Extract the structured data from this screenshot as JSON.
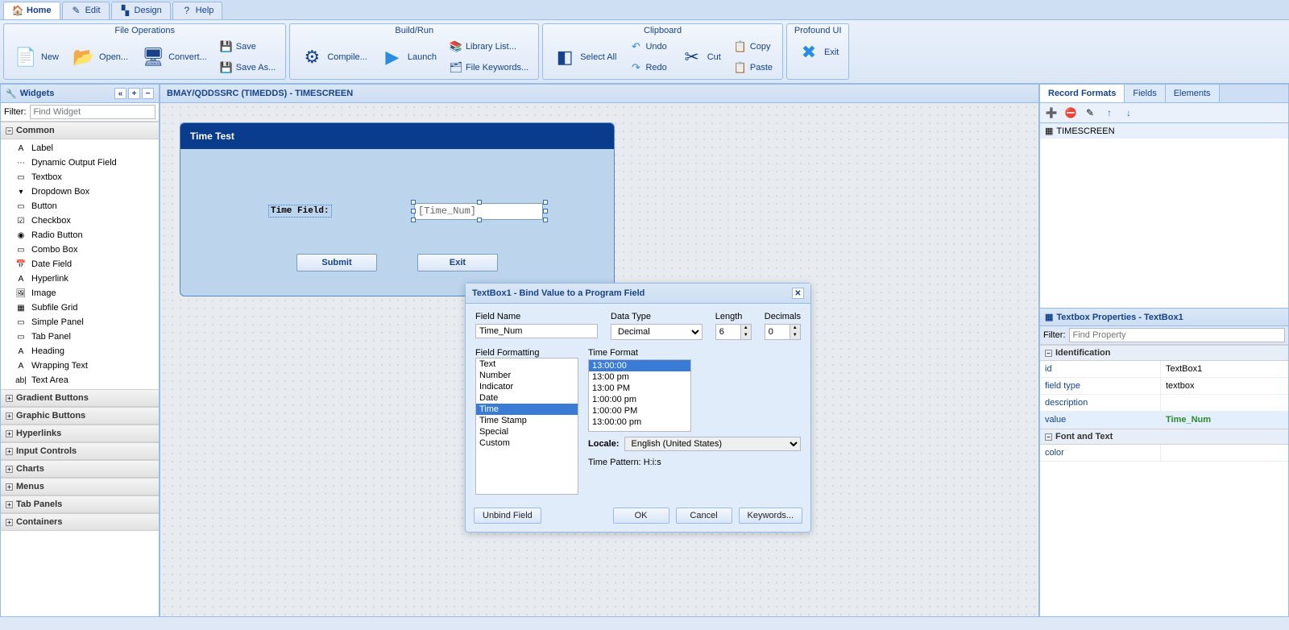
{
  "tabs": {
    "home": "Home",
    "edit": "Edit",
    "design": "Design",
    "help": "Help"
  },
  "ribbon": {
    "fileOps": {
      "title": "File Operations",
      "new": "New",
      "open": "Open...",
      "convert": "Convert...",
      "save": "Save",
      "saveAs": "Save As..."
    },
    "buildRun": {
      "title": "Build/Run",
      "compile": "Compile...",
      "launch": "Launch",
      "libList": "Library List...",
      "fileKw": "File Keywords..."
    },
    "clipboard": {
      "title": "Clipboard",
      "selectAll": "Select All",
      "undo": "Undo",
      "redo": "Redo",
      "cut": "Cut",
      "copy": "Copy",
      "paste": "Paste"
    },
    "profound": {
      "title": "Profound UI",
      "exit": "Exit"
    }
  },
  "widgets": {
    "title": "Widgets",
    "filterLabel": "Filter:",
    "filterPlaceholder": "Find Widget",
    "common": {
      "title": "Common",
      "items": [
        "Label",
        "Dynamic Output Field",
        "Textbox",
        "Dropdown Box",
        "Button",
        "Checkbox",
        "Radio Button",
        "Combo Box",
        "Date Field",
        "Hyperlink",
        "Image",
        "Subfile Grid",
        "Simple Panel",
        "Tab Panel",
        "Heading",
        "Wrapping Text",
        "Text Area"
      ]
    },
    "groups": [
      "Gradient Buttons",
      "Graphic Buttons",
      "Hyperlinks",
      "Input Controls",
      "Charts",
      "Menus",
      "Tab Panels",
      "Containers"
    ]
  },
  "canvas": {
    "title": "BMAY/QDDSSRC (TIMEDDS) - TIMESCREEN",
    "panelTitle": "Time Test",
    "fieldLabel": "Time Field:",
    "fieldValue": "[Time_Num]",
    "submit": "Submit",
    "exit": "Exit"
  },
  "dialog": {
    "title": "TextBox1 - Bind Value to a Program Field",
    "fieldNameLabel": "Field Name",
    "fieldName": "Time_Num",
    "dataTypeLabel": "Data Type",
    "dataType": "Decimal",
    "lengthLabel": "Length",
    "length": "6",
    "decimalsLabel": "Decimals",
    "decimals": "0",
    "formattingLabel": "Field Formatting",
    "formatOptions": [
      "Text",
      "Number",
      "Indicator",
      "Date",
      "Time",
      "Time Stamp",
      "Special",
      "Custom"
    ],
    "formatSelected": "Time",
    "timeFormatLabel": "Time Format",
    "timeFormats": [
      "13:00:00",
      "13:00 pm",
      "13:00 PM",
      "1:00:00 pm",
      "1:00:00 PM",
      "13:00:00 pm"
    ],
    "timeFormatSelected": "13:00:00",
    "localeLabel": "Locale:",
    "locale": "English (United States)",
    "timePatternLabel": "Time Pattern:",
    "timePattern": "H:i:s",
    "unbind": "Unbind Field",
    "ok": "OK",
    "cancel": "Cancel",
    "keywords": "Keywords..."
  },
  "right": {
    "tabs": {
      "records": "Record Formats",
      "fields": "Fields",
      "elements": "Elements"
    },
    "recItem": "TIMESCREEN",
    "propTitle": "Textbox Properties - TextBox1",
    "filterLabel": "Filter:",
    "filterPlaceholder": "Find Property",
    "sections": {
      "ident": "Identification",
      "font": "Font and Text"
    },
    "rows": {
      "id": {
        "k": "id",
        "v": "TextBox1"
      },
      "fieldType": {
        "k": "field type",
        "v": "textbox"
      },
      "description": {
        "k": "description",
        "v": ""
      },
      "value": {
        "k": "value",
        "v": "Time_Num"
      },
      "color": {
        "k": "color",
        "v": ""
      }
    }
  }
}
